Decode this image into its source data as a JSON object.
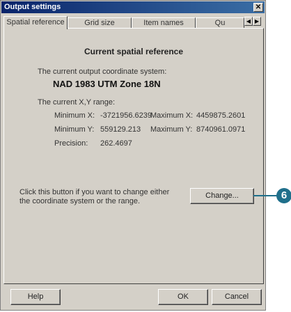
{
  "window": {
    "title": "Output settings",
    "close_glyph": "✕"
  },
  "tabs": [
    {
      "label": "Spatial reference",
      "active": true
    },
    {
      "label": "Grid size",
      "active": false
    },
    {
      "label": "Item names",
      "active": false
    },
    {
      "label": "Qu",
      "active": false
    }
  ],
  "tab_scroll": {
    "left": "◀",
    "right": "▶"
  },
  "panel": {
    "heading": "Current spatial reference",
    "coord_label": "The current output coordinate system:",
    "coord_value": "NAD 1983 UTM Zone 18N",
    "range_label": "The current X,Y range:",
    "min_x_label": "Minimum X:",
    "min_x_value": "-3721956.6239",
    "max_x_label": "Maximum X:",
    "max_x_value": "4459875.2601",
    "min_y_label": "Minimum Y:",
    "min_y_value": "559129.213",
    "max_y_label": "Maximum Y:",
    "max_y_value": "8740961.0971",
    "precision_label": "Precision:",
    "precision_value": "262.4697",
    "change_hint_line1": "Click this button if you want to change either",
    "change_hint_line2": "the coordinate system or the range.",
    "change_button": "Change..."
  },
  "footer": {
    "help": "Help",
    "ok": "OK",
    "cancel": "Cancel"
  },
  "callout": {
    "number": "6",
    "color": "#1f6f8b"
  }
}
